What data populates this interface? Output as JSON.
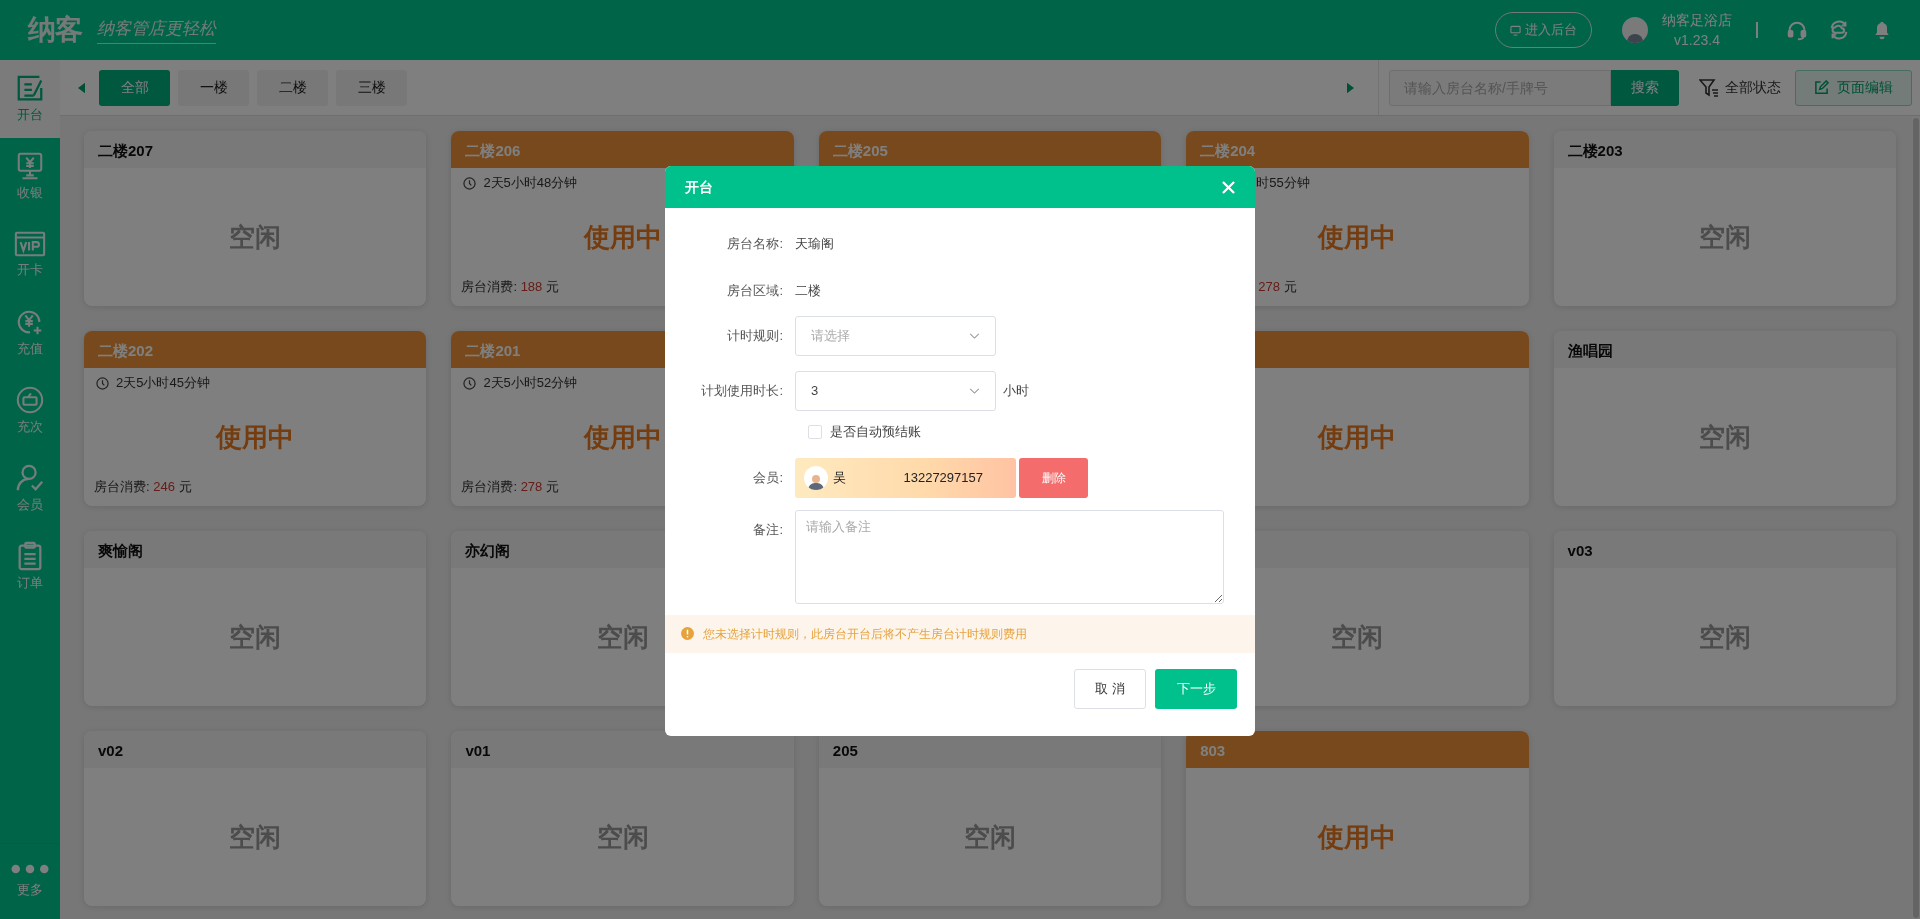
{
  "header": {
    "logo": "纳客",
    "slogan": "纳客管店更轻松",
    "backend_button": "进入后台",
    "store_name": "纳客足浴店",
    "version": "v1.23.4"
  },
  "sidebar": {
    "items": [
      {
        "label": "开台",
        "selected": true
      },
      {
        "label": "收银",
        "selected": false
      },
      {
        "label": "开卡",
        "selected": false
      },
      {
        "label": "充值",
        "selected": false
      },
      {
        "label": "充次",
        "selected": false
      },
      {
        "label": "会员",
        "selected": false
      },
      {
        "label": "订单",
        "selected": false
      }
    ],
    "more": "更多"
  },
  "toolbar": {
    "tabs": [
      {
        "label": "全部",
        "selected": true
      },
      {
        "label": "一楼",
        "selected": false
      },
      {
        "label": "二楼",
        "selected": false
      },
      {
        "label": "三楼",
        "selected": false
      }
    ],
    "search": {
      "placeholder": "请输入房台名称/手牌号"
    },
    "search_button": "搜索",
    "filter": "全部状态",
    "edit_button": "页面编辑"
  },
  "rooms": [
    {
      "kind": "room",
      "name": "二楼207",
      "in_use": false,
      "status_text": "空闲"
    },
    {
      "kind": "room",
      "name": "二楼206",
      "in_use": true,
      "timer": "2天5小时48分钟",
      "status_text": "使用中",
      "fee_label": "房台消费:",
      "fee_value": "188",
      "fee_unit": "元"
    },
    {
      "kind": "room",
      "name": "二楼205",
      "in_use": true
    },
    {
      "kind": "room",
      "name": "二楼204",
      "in_use": true,
      "cut": true,
      "timer": "时55分钟",
      "status_text": "使用中",
      "fee_value": "278",
      "fee_unit": "元"
    },
    {
      "kind": "room",
      "name": "二楼203",
      "in_use": false,
      "status_text": "空闲"
    },
    {
      "kind": "room",
      "name": "二楼202",
      "in_use": true,
      "timer": "2天5小时45分钟",
      "status_text": "使用中",
      "fee_label": "房台消费:",
      "fee_value": "246",
      "fee_unit": "元"
    },
    {
      "kind": "room",
      "name": "二楼201",
      "in_use": true,
      "timer": "2天5小时52分钟",
      "status_text": "使用中",
      "fee_label": "房台消费:",
      "fee_value": "278",
      "fee_unit": "元"
    },
    {
      "kind": "covered"
    },
    {
      "kind": "room",
      "in_use": true,
      "status_text": "使用中"
    },
    {
      "kind": "room",
      "name": "渔唱园",
      "in_use": false,
      "status_text": "空闲"
    },
    {
      "kind": "room",
      "name": "爽愉阁",
      "in_use": false,
      "status_text": "空闲"
    },
    {
      "kind": "room",
      "name": "亦幻阁",
      "in_use": false,
      "status_text": "空闲"
    },
    {
      "kind": "covered"
    },
    {
      "kind": "room",
      "in_use": false,
      "status_text": "空闲"
    },
    {
      "kind": "room",
      "name": "v03",
      "in_use": false,
      "status_text": "空闲"
    },
    {
      "kind": "room",
      "name": "v02",
      "in_use": false,
      "status_text": "空闲"
    },
    {
      "kind": "room",
      "name": "v01",
      "in_use": false,
      "status_text": "空闲"
    },
    {
      "kind": "room",
      "name": "205",
      "in_use": false,
      "status_text": "空闲"
    },
    {
      "kind": "room",
      "name": "803",
      "in_use": true,
      "status_text": "使用中"
    }
  ],
  "dialog": {
    "title": "开台",
    "room_name_label": "房台名称:",
    "room_name": "天瑜阁",
    "area_label": "房台区域:",
    "area": "二楼",
    "rule_label": "计时规则:",
    "rule": {
      "placeholder": "请选择"
    },
    "duration_label": "计划使用时长:",
    "duration": "3",
    "duration_unit": "小时",
    "auto_checkout": {
      "label": "是否自动预结账",
      "checked": false
    },
    "member_label": "会员:",
    "member": {
      "name": "吴",
      "phone": "13227297157"
    },
    "delete_button": "删除",
    "note_label": "备注:",
    "note": {
      "placeholder": "请输入备注"
    },
    "warning": "您未选择计时规则，此房台开台后将不产生房台计时规则费用",
    "cancel_button": "取 消",
    "next_button": "下一步"
  }
}
